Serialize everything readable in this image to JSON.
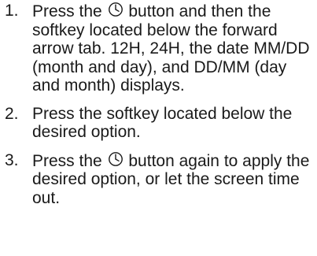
{
  "steps": [
    {
      "number": "1.",
      "before_icon": "Press the ",
      "icon": "clock-icon",
      "after_icon": " button and then the softkey located below the forward arrow tab. 12H, 24H, the date MM/DD (month and day), and DD/MM (day and month) displays."
    },
    {
      "number": "2.",
      "text": "Press the softkey located below the desired option."
    },
    {
      "number": "3.",
      "before_icon": "Press the ",
      "icon": "clock-icon",
      "after_icon": " button again to apply the desired option, or let the screen time out."
    }
  ]
}
